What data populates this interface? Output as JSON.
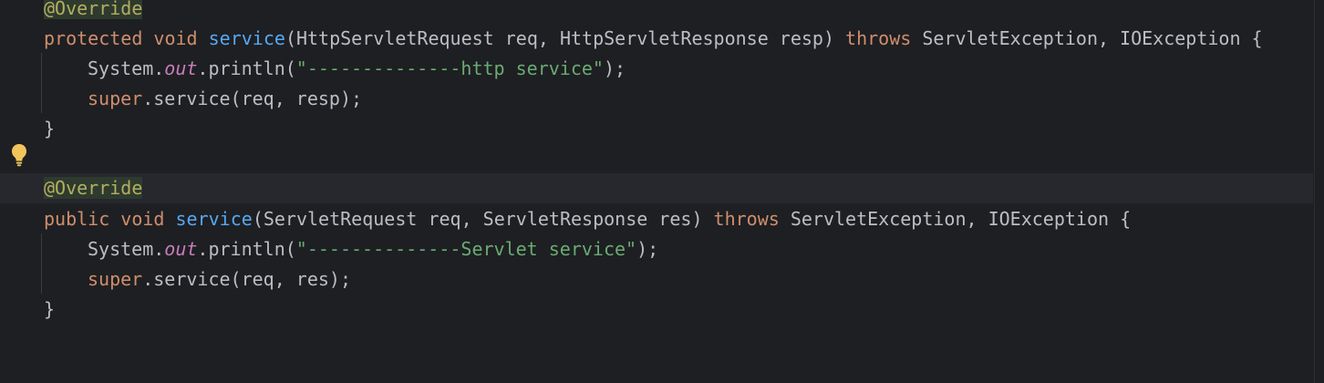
{
  "colors": {
    "background": "#1e1f22",
    "current_line": "#26282e",
    "keyword": "#cf8e6d",
    "annotation": "#b3ae60",
    "method": "#56a8f5",
    "string": "#6aab73",
    "static_field": "#c77dbb",
    "plain": "#bcbec4",
    "bulb": "#f2c55c"
  },
  "icons": {
    "gutter": "lightbulb-icon"
  },
  "code": {
    "block1": {
      "annotation": "@Override",
      "modifier": "protected",
      "return_type": "void",
      "method": "service",
      "params": "(HttpServletRequest req, HttpServletResponse resp) ",
      "throws_kw": "throws",
      "exceptions": " ServletException, IOException {",
      "print_prefix": "System.",
      "print_field": "out",
      "print_call": ".println(",
      "print_string": "\"--------------http service\"",
      "print_end": ");",
      "super_kw": "super",
      "super_call": ".service(req, resp);",
      "close": "}"
    },
    "block2": {
      "annotation": "@Override",
      "modifier": "public",
      "return_type": "void",
      "method": "service",
      "params": "(ServletRequest req, ServletResponse res) ",
      "throws_kw": "throws",
      "exceptions": " ServletException, IOException {",
      "print_prefix": "System.",
      "print_field": "out",
      "print_call": ".println(",
      "print_string": "\"--------------Servlet service\"",
      "print_end": ");",
      "super_kw": "super",
      "super_call": ".service(req, res);",
      "close": "}"
    }
  }
}
